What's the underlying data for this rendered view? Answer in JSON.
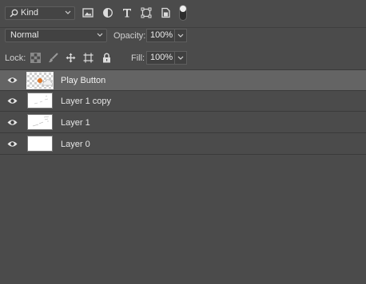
{
  "filter_bar": {
    "kind_label": "Kind",
    "icons": [
      "search-icon",
      "image-filter-icon",
      "adjustment-filter-icon",
      "type-filter-icon",
      "shape-filter-icon",
      "smart-object-filter-icon",
      "filter-toggle-icon"
    ]
  },
  "blend_bar": {
    "blend_mode": "Normal",
    "opacity_label": "Opacity:",
    "opacity_value": "100%"
  },
  "lock_bar": {
    "lock_label": "Lock:",
    "fill_label": "Fill:",
    "fill_value": "100%"
  },
  "layers": [
    {
      "name": "Play Button",
      "selected": true,
      "visible": true
    },
    {
      "name": "Layer 1 copy",
      "selected": false,
      "visible": true
    },
    {
      "name": "Layer 1",
      "selected": false,
      "visible": true
    },
    {
      "name": "Layer 0",
      "selected": false,
      "visible": true
    }
  ]
}
